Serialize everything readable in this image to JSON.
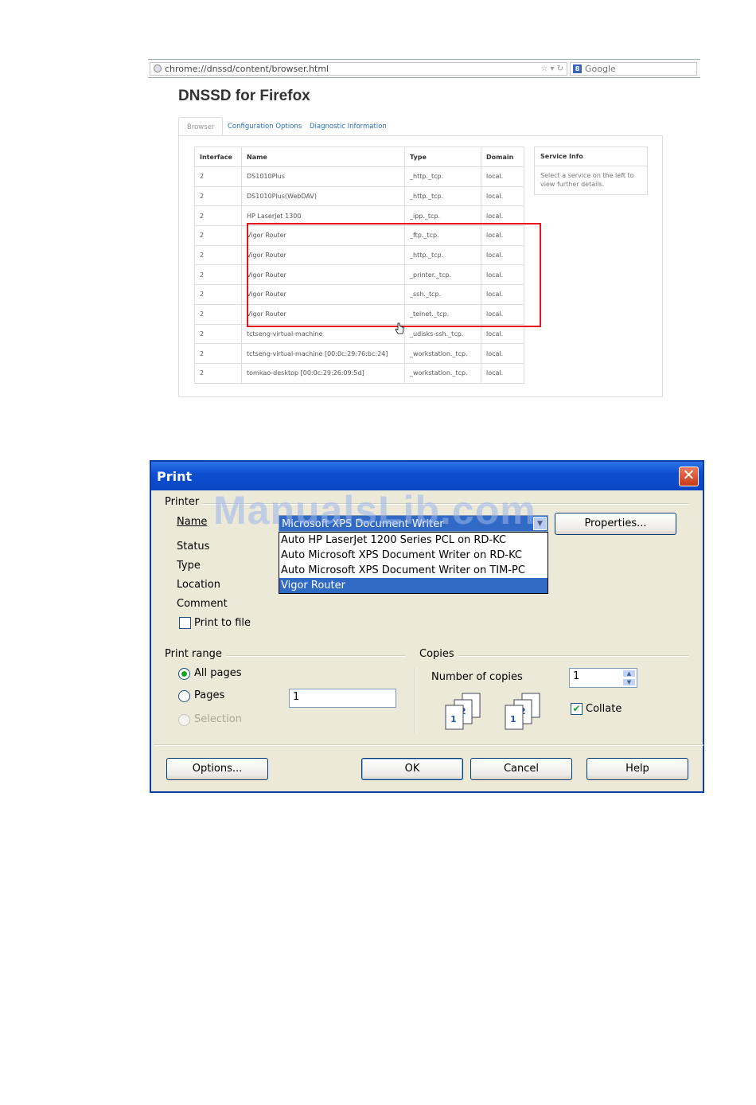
{
  "browser": {
    "url": "chrome://dnssd/content/browser.html",
    "search_placeholder": "Google",
    "search_engine_letter": "8",
    "page_title": "DNSSD for Firefox",
    "tabs": [
      {
        "label": "Browser",
        "active": true
      },
      {
        "label": "Configuration Options",
        "active": false
      },
      {
        "label": "Diagnostic Information",
        "active": false
      }
    ],
    "table": {
      "headers": [
        "Interface",
        "Name",
        "Type",
        "Domain"
      ],
      "rows": [
        [
          "2",
          "DS1010Plus",
          "_http._tcp.",
          "local."
        ],
        [
          "2",
          "DS1010Plus(WebDAV)",
          "_http._tcp.",
          "local."
        ],
        [
          "2",
          "HP LaserJet 1300",
          "_ipp._tcp.",
          "local."
        ],
        [
          "2",
          "Vigor Router",
          "_ftp._tcp.",
          "local."
        ],
        [
          "2",
          "Vigor Router",
          "_http._tcp.",
          "local."
        ],
        [
          "2",
          "Vigor Router",
          "_printer._tcp.",
          "local."
        ],
        [
          "2",
          "Vigor Router",
          "_ssh._tcp.",
          "local."
        ],
        [
          "2",
          "Vigor Router",
          "_telnet._tcp.",
          "local."
        ],
        [
          "2",
          "tctseng-virtual-machine",
          "_udisks-ssh._tcp.",
          "local."
        ],
        [
          "2",
          "tctseng-virtual-machine [00:0c:29:76:bc:24]",
          "_workstation._tcp.",
          "local."
        ],
        [
          "2",
          "tomkao-desktop [00:0c:29:26:09:5d]",
          "_workstation._tcp.",
          "local."
        ]
      ]
    },
    "service_info": {
      "title": "Service Info",
      "text": "Select a service on the left to view further details."
    },
    "highlight_color": "#e8141e"
  },
  "print_dialog": {
    "title": "Print",
    "printer_group": "Printer",
    "name_label": "Name",
    "selected_printer": "Microsoft XPS Document Writer",
    "printer_options": [
      "Auto HP LaserJet 1200 Series PCL on RD-KC",
      "Auto Microsoft XPS Document Writer on RD-KC",
      "Auto Microsoft XPS Document Writer on TIM-PC",
      "Vigor Router"
    ],
    "highlighted_option": "Vigor Router",
    "properties_button": "Properties...",
    "status_label": "Status",
    "type_label": "Type",
    "location_label": "Location",
    "comment_label": "Comment",
    "print_to_file_label": "Print to file",
    "print_to_file_checked": false,
    "print_range_group": "Print range",
    "all_pages_label": "All pages",
    "pages_label": "Pages",
    "pages_value": "1",
    "selection_label": "Selection",
    "range_selected": "All pages",
    "copies_group": "Copies",
    "number_of_copies_label": "Number of copies",
    "copies_value": "1",
    "collate_label": "Collate",
    "collate_checked": true,
    "options_button": "Options...",
    "ok_button": "OK",
    "cancel_button": "Cancel",
    "help_button": "Help",
    "colors": {
      "titlebar": "#0a46c4",
      "selection": "#316ac5",
      "face": "#ece9d8"
    }
  },
  "watermark": "ManualsLib.com"
}
